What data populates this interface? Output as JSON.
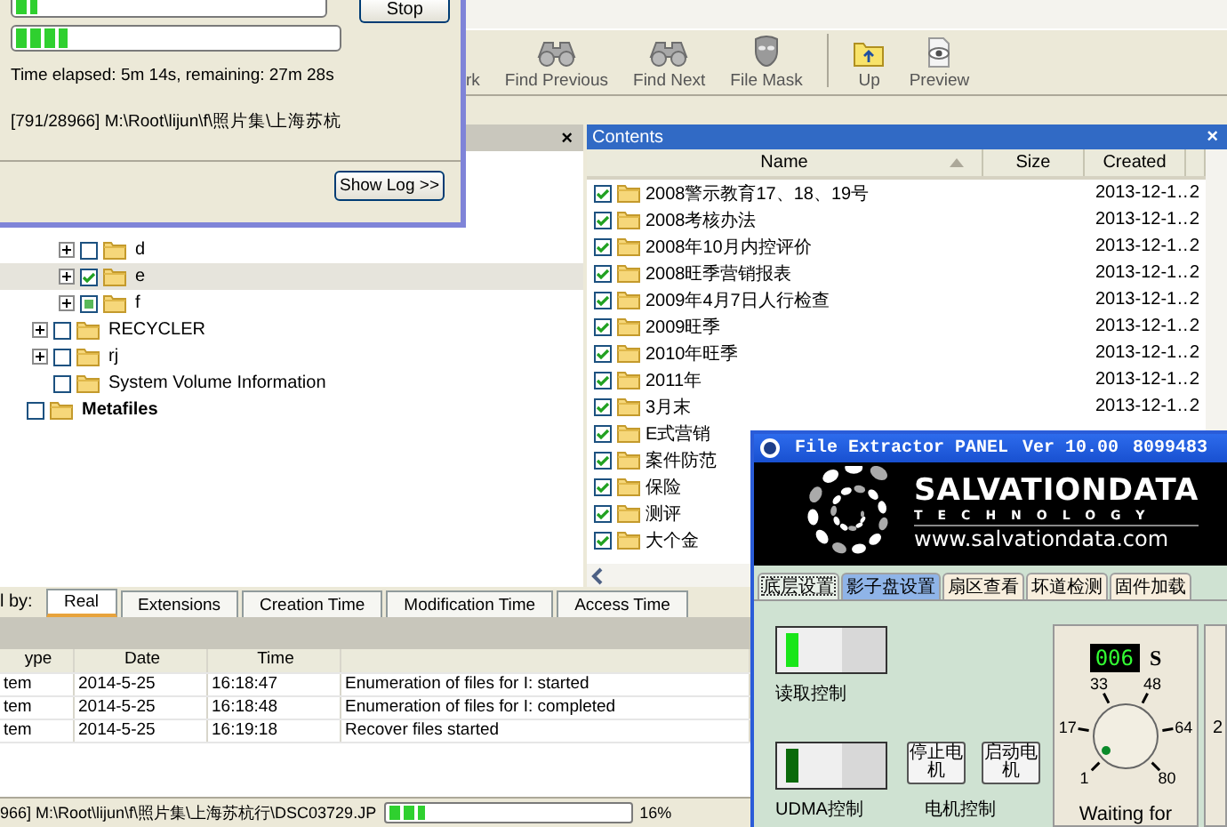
{
  "progress_dialog": {
    "bars": [
      {
        "level": 0.07
      },
      {
        "level": 0.16
      }
    ],
    "stop_button": "Stop",
    "time_text": "Time elapsed: 5m 14s, remaining: 27m 28s",
    "path_text": "[791/28966] M:\\Root\\lijun\\f\\照片集\\上海苏杭",
    "show_log_button": "Show Log >>"
  },
  "toolbar": [
    {
      "label": "rk"
    },
    {
      "label": "Find Previous"
    },
    {
      "label": "Find Next"
    },
    {
      "label": "File Mask"
    },
    {
      "label": "Up"
    },
    {
      "label": "Preview"
    }
  ],
  "folder_pane": {
    "close": "×",
    "tree": [
      {
        "children": [
          {
            "children": [
              {
                "label": "d",
                "checked": false,
                "partial": false,
                "expandable": true,
                "selected": false
              },
              {
                "label": "e",
                "checked": true,
                "partial": false,
                "expandable": true,
                "selected": true
              },
              {
                "label": "f",
                "checked": false,
                "partial": true,
                "expandable": true,
                "selected": false
              }
            ]
          },
          {
            "label": "RECYCLER",
            "checked": false,
            "partial": false,
            "expandable": true,
            "selected": false
          },
          {
            "label": "rj",
            "checked": false,
            "partial": false,
            "expandable": true,
            "selected": false
          },
          {
            "label": "System Volume Information",
            "checked": false,
            "partial": false,
            "expandable": false,
            "selected": false
          }
        ]
      },
      {
        "label": "Metafiles",
        "checked": false,
        "partial": false,
        "expandable": false,
        "selected": false
      }
    ]
  },
  "contents": {
    "title": "Contents",
    "close": "×",
    "columns": [
      {
        "label": "Name",
        "sorted": true
      },
      {
        "label": "Size",
        "sorted": false
      },
      {
        "label": "Created",
        "sorted": false
      }
    ],
    "rows": [
      {
        "name": "2008警示教育17、18、19号",
        "checked": true,
        "created": "2013-12-1…",
        "column_4": "2"
      },
      {
        "name": "2008考核办法",
        "checked": true,
        "created": "2013-12-1…",
        "column_4": "2"
      },
      {
        "name": "2008年10月内控评价",
        "checked": true,
        "created": "2013-12-1…",
        "column_4": "2"
      },
      {
        "name": "2008旺季营销报表",
        "checked": true,
        "created": "2013-12-1…",
        "column_4": "2"
      },
      {
        "name": "2009年4月7日人行检查",
        "checked": true,
        "created": "2013-12-1…",
        "column_4": "2"
      },
      {
        "name": "2009旺季",
        "checked": true,
        "created": "2013-12-1…",
        "column_4": "2"
      },
      {
        "name": "2010年旺季",
        "checked": true,
        "created": "2013-12-1…",
        "column_4": "2"
      },
      {
        "name": "2011年",
        "checked": true,
        "created": "2013-12-1…",
        "column_4": "2"
      },
      {
        "name": "3月末",
        "checked": true,
        "created": "2013-12-1…",
        "column_4": "2"
      },
      {
        "name": "E式营销",
        "checked": true
      },
      {
        "name": "案件防范",
        "checked": true
      },
      {
        "name": "保险",
        "checked": true
      },
      {
        "name": "测评",
        "checked": true
      },
      {
        "name": "大个金",
        "checked": true
      }
    ]
  },
  "sort_tabs": {
    "caption": "l by:",
    "tabs": [
      {
        "label": "Real",
        "selected": true
      },
      {
        "label": "Extensions",
        "selected": false
      },
      {
        "label": "Creation Time",
        "selected": false
      },
      {
        "label": "Modification Time",
        "selected": false
      },
      {
        "label": "Access Time",
        "selected": false
      }
    ]
  },
  "log": {
    "columns": [
      "ype",
      "Date",
      "Time"
    ],
    "rows": [
      {
        "column_1": "tem",
        "date": "2014-5-25",
        "time": "16:18:47",
        "message": "Enumeration of files for I: started"
      },
      {
        "column_1": "tem",
        "date": "2014-5-25",
        "time": "16:18:48",
        "message": "Enumeration of files for I: completed"
      },
      {
        "column_1": "tem",
        "date": "2014-5-25",
        "time": "16:19:18",
        "message": "Recover files started"
      }
    ]
  },
  "status_bar": {
    "path": "966] M:\\Root\\lijun\\f\\照片集\\上海苏杭行\\DSC03729.JP",
    "level": 0.15,
    "percent": "16%"
  },
  "panel": {
    "title": "File Extractor PANEL",
    "version": "Ver 10.00",
    "serial": "8099483",
    "logo_name": "SALVATIONDATA",
    "logo_tagline": "TECHNOLOGY",
    "url": "www.salvationdata.com",
    "tabs": [
      {
        "label": "底层设置",
        "selected": true,
        "hover": false
      },
      {
        "label": "影子盘设置",
        "selected": false,
        "hover": true
      },
      {
        "label": "扇区查看",
        "selected": false,
        "hover": false
      },
      {
        "label": "坏道检测",
        "selected": false,
        "hover": false
      },
      {
        "label": "固件加载",
        "selected": false,
        "hover": false
      }
    ],
    "switches": [
      {
        "label": "读取控制",
        "on": true
      },
      {
        "label": "UDMA控制",
        "on": false
      }
    ],
    "motor_buttons": [
      "停止电机",
      "启动电机"
    ],
    "motor_label": "电机控制",
    "timer": {
      "display": "006",
      "unit": "S",
      "dial_labels": [
        "1",
        "17",
        "33",
        "48",
        "64",
        "80"
      ],
      "status": "Waiting for"
    },
    "side_text": "2"
  }
}
